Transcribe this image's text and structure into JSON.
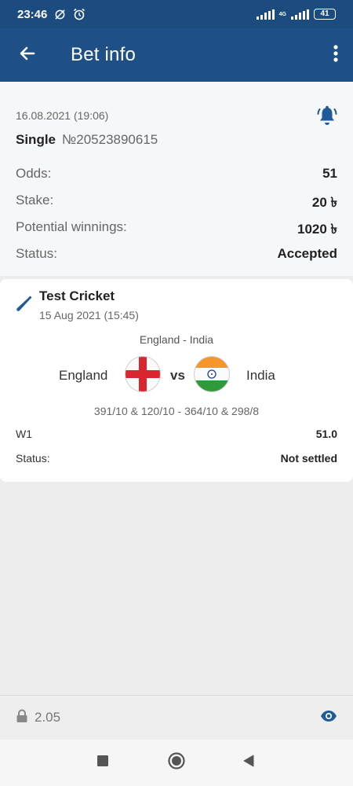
{
  "status_bar": {
    "time": "23:46",
    "network": "4G",
    "battery": "41"
  },
  "app_bar": {
    "title": "Bet info"
  },
  "bet": {
    "date": "16.08.2021 (19:06)",
    "type": "Single",
    "number": "№20523890615",
    "rows": [
      {
        "label": "Odds:",
        "value": "51"
      },
      {
        "label": "Stake:",
        "value": "20 ৳"
      },
      {
        "label": "Potential winnings:",
        "value": "1020 ৳"
      },
      {
        "label": "Status:",
        "value": "Accepted"
      }
    ]
  },
  "event": {
    "sport": "Test Cricket",
    "date": "15 Aug 2021 (15:45)",
    "match": "England - India",
    "team1": "England",
    "vs": "vs",
    "team2": "India",
    "score": "391/10 & 120/10 - 364/10 & 298/8",
    "pick": {
      "label": "W1",
      "value": "51.0"
    },
    "status": {
      "label": "Status:",
      "value": "Not settled"
    }
  },
  "footer": {
    "version": "2.05"
  },
  "icons": {
    "back": "arrow-left-icon",
    "menu": "more-vertical-icon",
    "bell": "bell-icon",
    "sport": "cricket-bat-icon",
    "lock": "lock-icon",
    "eye": "eye-icon"
  },
  "colors": {
    "primary": "#1e4f86",
    "status_bar": "#1c4b80",
    "accent": "#1f5b96"
  }
}
